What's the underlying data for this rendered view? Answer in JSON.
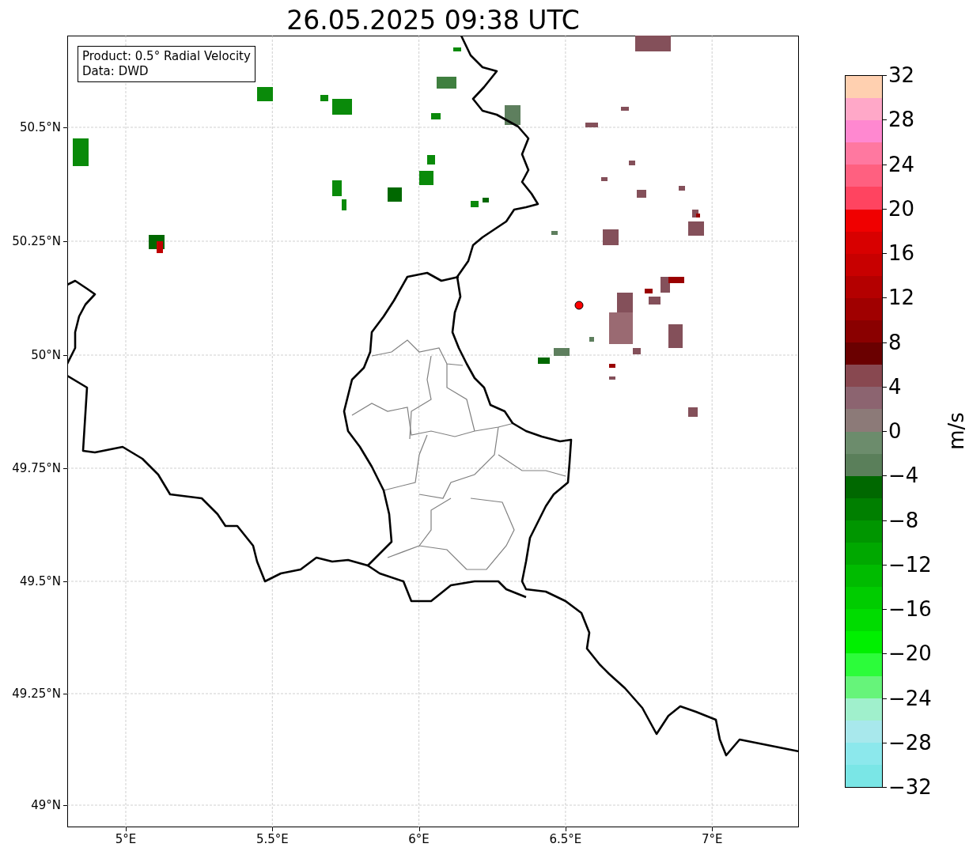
{
  "title": "26.05.2025 09:38 UTC",
  "info_box": {
    "lines": [
      "Product: 0.5° Radial Velocity",
      "Data: DWD"
    ]
  },
  "map": {
    "x_ticks": [
      "5°E",
      "5.5°E",
      "6°E",
      "6.5°E",
      "7°E"
    ],
    "y_ticks": [
      "50.5°N",
      "50.25°N",
      "50°N",
      "49.75°N",
      "49.5°N",
      "49.25°N",
      "49°N"
    ]
  },
  "colorbar": {
    "label": "m/s",
    "ticks": [
      "32",
      "28",
      "24",
      "20",
      "16",
      "12",
      "8",
      "4",
      "0",
      "−4",
      "−8",
      "−12",
      "−16",
      "−20",
      "−24",
      "−28",
      "−32"
    ],
    "bins": [
      {
        "color": "#ffd0b0"
      },
      {
        "color": "#ffa8c8"
      },
      {
        "color": "#ff88d0"
      },
      {
        "color": "#ff78a0"
      },
      {
        "color": "#ff6080"
      },
      {
        "color": "#ff4460"
      },
      {
        "color": "#f00000"
      },
      {
        "color": "#d80000"
      },
      {
        "color": "#c80000"
      },
      {
        "color": "#b40000"
      },
      {
        "color": "#a00000"
      },
      {
        "color": "#8a0000"
      },
      {
        "color": "#6a0000"
      },
      {
        "color": "#884850"
      },
      {
        "color": "#8c6470"
      },
      {
        "color": "#8c7a78"
      },
      {
        "color": "#6c8c6c"
      },
      {
        "color": "#5a7f5a"
      },
      {
        "color": "#006800"
      },
      {
        "color": "#007f00"
      },
      {
        "color": "#009600"
      },
      {
        "color": "#00a800"
      },
      {
        "color": "#00bb00"
      },
      {
        "color": "#00cc00"
      },
      {
        "color": "#00dc00"
      },
      {
        "color": "#00f000"
      },
      {
        "color": "#2cfc3a"
      },
      {
        "color": "#66f47a"
      },
      {
        "color": "#a0f0cc"
      },
      {
        "color": "#a8e8ec"
      },
      {
        "color": "#8ce8ec"
      },
      {
        "color": "#7ae6e6"
      }
    ]
  }
}
